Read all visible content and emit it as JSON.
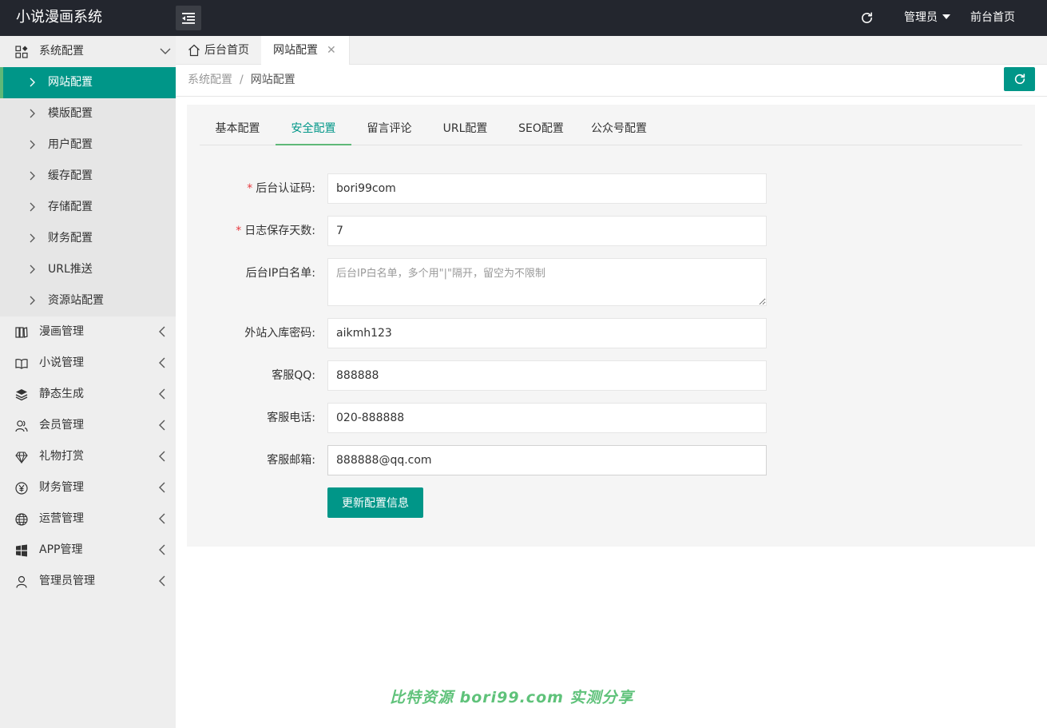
{
  "header": {
    "logo": "小说漫画系统",
    "user": "管理员",
    "front_link": "前台首页"
  },
  "sidebar": {
    "groups": [
      {
        "label": "系统配置",
        "icon": "grid-icon",
        "expanded": true,
        "items": [
          {
            "label": "网站配置",
            "active": true
          },
          {
            "label": "模版配置"
          },
          {
            "label": "用户配置"
          },
          {
            "label": "缓存配置"
          },
          {
            "label": "存储配置"
          },
          {
            "label": "财务配置"
          },
          {
            "label": "URL推送"
          },
          {
            "label": "资源站配置"
          }
        ]
      },
      {
        "label": "漫画管理",
        "icon": "comic-icon"
      },
      {
        "label": "小说管理",
        "icon": "book-icon"
      },
      {
        "label": "静态生成",
        "icon": "layers-icon"
      },
      {
        "label": "会员管理",
        "icon": "users-icon"
      },
      {
        "label": "礼物打赏",
        "icon": "diamond-icon"
      },
      {
        "label": "财务管理",
        "icon": "yuan-icon"
      },
      {
        "label": "运营管理",
        "icon": "globe-icon"
      },
      {
        "label": "APP管理",
        "icon": "windows-icon"
      },
      {
        "label": "管理员管理",
        "icon": "user-icon"
      }
    ]
  },
  "tabs": {
    "home": "后台首页",
    "current": "网站配置",
    "close": "✕"
  },
  "breadcrumb": {
    "parent": "系统配置",
    "separator": "/",
    "current": "网站配置"
  },
  "form_tabs": [
    "基本配置",
    "安全配置",
    "留言评论",
    "URL配置",
    "SEO配置",
    "公众号配置"
  ],
  "form_tabs_active": 1,
  "form": {
    "required_mark": "*",
    "auth_code": {
      "label": "后台认证码:",
      "value": "bori99com"
    },
    "log_days": {
      "label": "日志保存天数:",
      "value": "7"
    },
    "ip_whitelist": {
      "label": "后台IP白名单:",
      "placeholder": "后台IP白名单，多个用\"|\"隔开，留空为不限制"
    },
    "import_password": {
      "label": "外站入库密码:",
      "value": "aikmh123"
    },
    "service_qq": {
      "label": "客服QQ:",
      "value": "888888"
    },
    "service_phone": {
      "label": "客服电话:",
      "value": "020-888888"
    },
    "service_email": {
      "label": "客服邮箱:",
      "value": "888888@qq.com"
    },
    "submit_label": "更新配置信息"
  },
  "watermark": "比特资源 bori99.com 实测分享",
  "colors": {
    "primary": "#009688",
    "header_bg": "#23262e",
    "active_bar": "#5fb878",
    "required": "#e6393e"
  }
}
